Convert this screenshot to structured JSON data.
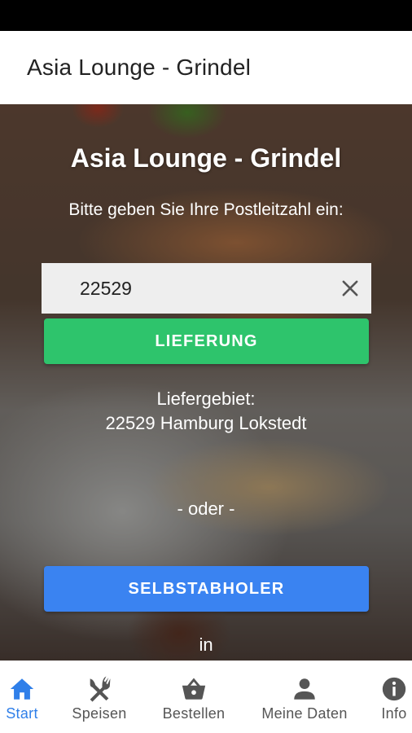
{
  "app_bar": {
    "title": "Asia Lounge - Grindel"
  },
  "hero": {
    "title": "Asia Lounge - Grindel",
    "prompt": "Bitte geben Sie Ihre Postleitzahl ein:",
    "zip_value": "22529",
    "delivery_button": "LIEFERUNG",
    "delivery_area_label": "Liefergebiet:",
    "delivery_area_value": "22529 Hamburg Lokstedt",
    "or_text": "- oder -",
    "pickup_button": "SELBSTABHOLER",
    "in_text": "in"
  },
  "colors": {
    "delivery_button": "#2ec46c",
    "pickup_button": "#3a83f1",
    "active_nav": "#2f7fe9",
    "inactive_nav": "#555555"
  },
  "bottom_nav": {
    "items": [
      {
        "label": "Start",
        "icon": "home-icon",
        "active": true
      },
      {
        "label": "Speisen",
        "icon": "fork-knife-icon",
        "active": false
      },
      {
        "label": "Bestellen",
        "icon": "basket-icon",
        "active": false
      },
      {
        "label": "Meine Daten",
        "icon": "person-icon",
        "active": false
      },
      {
        "label": "Info",
        "icon": "info-icon",
        "active": false
      }
    ]
  }
}
